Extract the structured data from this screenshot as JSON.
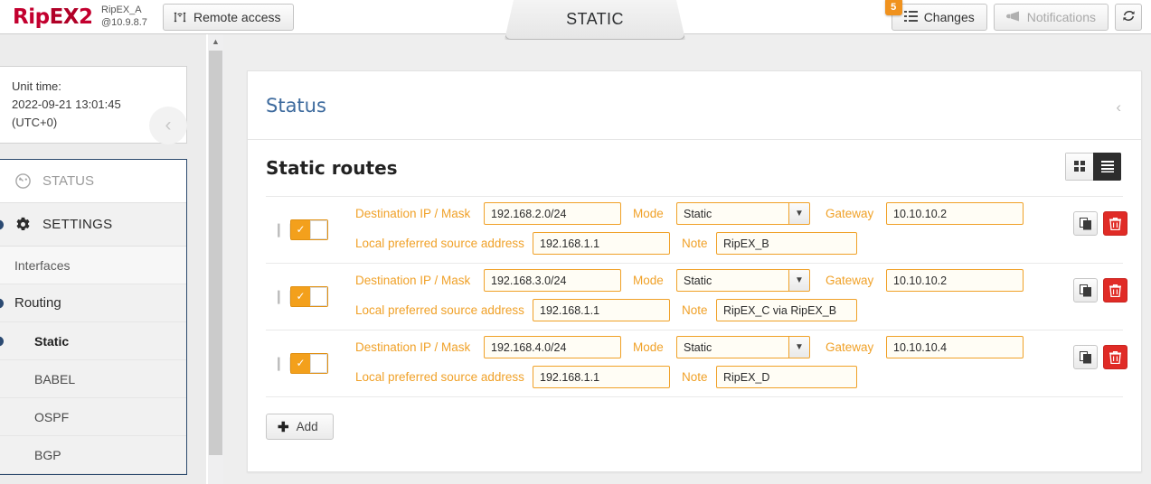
{
  "topbar": {
    "brand_rip": "Rip",
    "brand_ex": "EX",
    "brand_two": "2",
    "unit_name": "RipEX_A",
    "unit_addr": "@10.9.8.7",
    "remote_access_label": "Remote access",
    "remote_access_icon": "antenna-icon",
    "center_tab_label": "STATIC",
    "changes_label": "Changes",
    "changes_badge": "5",
    "changes_icon": "list-icon",
    "notifications_label": "Notifications",
    "notifications_icon": "megaphone-icon",
    "refresh_icon": "refresh-icon"
  },
  "sidebar": {
    "unit_time_label": "Unit time:",
    "unit_time_value": "2022-09-21 13:01:45",
    "unit_time_zone": "(UTC+0)",
    "collapse_icon": "chevron-left-icon",
    "items": [
      {
        "label": "STATUS",
        "icon": "gauge-icon",
        "level": "top",
        "active": false,
        "marker": false
      },
      {
        "label": "SETTINGS",
        "icon": "gear-icon",
        "level": "top",
        "active": false,
        "marker": true
      },
      {
        "label": "Interfaces",
        "icon": "",
        "level": "sub",
        "active": false,
        "marker": false
      },
      {
        "label": "Routing",
        "icon": "",
        "level": "sub",
        "active": false,
        "marker": true
      },
      {
        "label": "Static",
        "icon": "",
        "level": "sub2",
        "active": true,
        "marker": true
      },
      {
        "label": "BABEL",
        "icon": "",
        "level": "sub2",
        "active": false,
        "marker": false
      },
      {
        "label": "OSPF",
        "icon": "",
        "level": "sub2",
        "active": false,
        "marker": false
      },
      {
        "label": "BGP",
        "icon": "",
        "level": "sub2",
        "active": false,
        "marker": false
      }
    ],
    "scrollbar_up_icon": "chevron-up-icon"
  },
  "card": {
    "status_title": "Status",
    "status_collapse_icon": "chevron-left-icon",
    "section_title": "Static routes",
    "view_grid_icon": "grid-view-icon",
    "view_list_icon": "list-view-icon",
    "add_label": "Add",
    "add_icon": "plus-icon"
  },
  "labels": {
    "destination": "Destination IP / Mask",
    "mode": "Mode",
    "gateway": "Gateway",
    "local_source": "Local preferred source address",
    "note": "Note",
    "copy_icon": "copy-icon",
    "delete_icon": "trash-icon",
    "drag_icon": "drag-handle-icon",
    "select_chevron_icon": "chevron-down-icon",
    "toggle_check_icon": "check-icon"
  },
  "routes": [
    {
      "enabled": true,
      "destination": "192.168.2.0/24",
      "mode": "Static",
      "gateway": "10.10.10.2",
      "local_source": "192.168.1.1",
      "note": "RipEX_B"
    },
    {
      "enabled": true,
      "destination": "192.168.3.0/24",
      "mode": "Static",
      "gateway": "10.10.10.2",
      "local_source": "192.168.1.1",
      "note": "RipEX_C via RipEX_B"
    },
    {
      "enabled": true,
      "destination": "192.168.4.0/24",
      "mode": "Static",
      "gateway": "10.10.10.4",
      "local_source": "192.168.1.1",
      "note": "RipEX_D"
    }
  ],
  "colors": {
    "brand_red": "#c3002f",
    "accent_orange": "#f0a128",
    "badge_orange": "#f0921e",
    "title_blue": "#3e6b9e",
    "marker_blue": "#2b4a72",
    "delete_red": "#e02b26"
  }
}
